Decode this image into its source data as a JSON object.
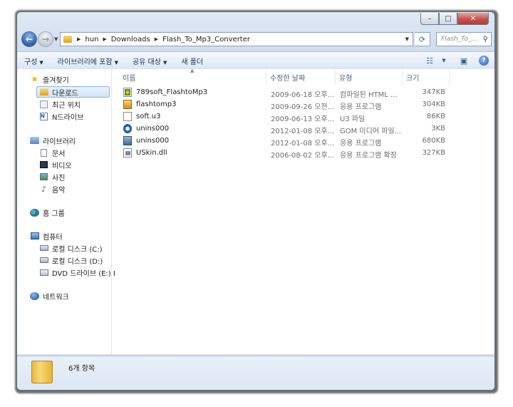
{
  "window": {
    "controls": {
      "minimize": "–",
      "maximize": "□",
      "close": "✕"
    }
  },
  "address": {
    "crumbs": [
      "hun",
      "Downloads",
      "Flash_To_Mp3_Converter"
    ],
    "search_placeholder": "Flash_To_..."
  },
  "toolbar": {
    "organize": "구성",
    "include_library": "라이브러리에 포함",
    "share_with": "공유 대상",
    "new_folder": "새 폴더"
  },
  "sidebar": {
    "favorites": {
      "label": "즐겨찾기",
      "items": [
        "다운로드",
        "최근 위치",
        "N드라이브"
      ]
    },
    "libraries": {
      "label": "라이브러리",
      "items": [
        "문서",
        "비디오",
        "사진",
        "음악"
      ]
    },
    "homegroup": "홈 그룹",
    "computer": {
      "label": "컴퓨터",
      "items": [
        "로컬 디스크 (C:)",
        "로컬 디스크 (D:)",
        "DVD 드라이브 (E:) I"
      ]
    },
    "network": "네트워크"
  },
  "columns": {
    "name": "이름",
    "date": "수정한 날짜",
    "type": "유형",
    "size": "크기"
  },
  "files": [
    {
      "name": "789soft_FlashtoMp3",
      "date": "2009-06-18 오후...",
      "type": "컴파일된 HTML ...",
      "size": "347KB",
      "icon": "chm-icon"
    },
    {
      "name": "flashtomp3",
      "date": "2009-09-26 오전...",
      "type": "응용 프로그램",
      "size": "304KB",
      "icon": "application-icon"
    },
    {
      "name": "soft.u3",
      "date": "2009-06-13 오후...",
      "type": "U3 파일",
      "size": "86KB",
      "icon": "file-icon"
    },
    {
      "name": "unins000",
      "date": "2012-01-08 오후...",
      "type": "GOM 미디어 파일...",
      "size": "3KB",
      "icon": "gom-media-icon"
    },
    {
      "name": "unins000",
      "date": "2012-01-08 오후...",
      "type": "응용 프로그램",
      "size": "680KB",
      "icon": "installer-icon"
    },
    {
      "name": "USkin.dll",
      "date": "2006-08-02 오후...",
      "type": "응용 프로그램 확장",
      "size": "327KB",
      "icon": "dll-icon"
    }
  ],
  "status": {
    "item_count": "6개 항목"
  }
}
